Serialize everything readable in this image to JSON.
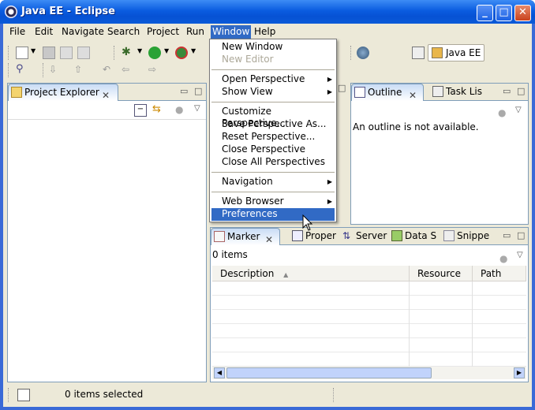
{
  "window": {
    "title": "Java EE - Eclipse"
  },
  "menubar": [
    {
      "label": "File"
    },
    {
      "label": "Edit"
    },
    {
      "label": "Navigate"
    },
    {
      "label": "Search"
    },
    {
      "label": "Project"
    },
    {
      "label": "Run"
    },
    {
      "label": "Window"
    },
    {
      "label": "Help"
    }
  ],
  "perspective": {
    "label": "Java EE"
  },
  "project_explorer": {
    "tab_label": "Project Explorer"
  },
  "outline": {
    "tab_label": "Outline",
    "message": "An outline is not available.",
    "task_tab": "Task Lis"
  },
  "markers": {
    "tabs": [
      {
        "label": "Marker"
      },
      {
        "label": "Proper"
      },
      {
        "label": "Server"
      },
      {
        "label": "Data S"
      },
      {
        "label": "Snippe"
      }
    ],
    "count_text": "0 items",
    "columns": [
      {
        "label": "Description"
      },
      {
        "label": "Resource"
      },
      {
        "label": "Path"
      }
    ]
  },
  "window_menu": {
    "items": [
      {
        "label": "New Window",
        "enabled": true
      },
      {
        "label": "New Editor",
        "enabled": false
      },
      {
        "label": "Open Perspective",
        "enabled": true,
        "submenu": true
      },
      {
        "label": "Show View",
        "enabled": true,
        "submenu": true
      },
      {
        "label": "Customize Perspective...",
        "enabled": true
      },
      {
        "label": "Save Perspective As...",
        "enabled": true
      },
      {
        "label": "Reset Perspective...",
        "enabled": true
      },
      {
        "label": "Close Perspective",
        "enabled": true
      },
      {
        "label": "Close All Perspectives",
        "enabled": true
      },
      {
        "label": "Navigation",
        "enabled": true,
        "submenu": true
      },
      {
        "label": "Web Browser",
        "enabled": true,
        "submenu": true
      },
      {
        "label": "Preferences",
        "enabled": true,
        "selected": true
      }
    ]
  },
  "status": {
    "text": "0 items selected"
  },
  "colors": {
    "selection": "#316ac5",
    "titlebar": "#0a5ce0",
    "chrome": "#ece9d8",
    "border": "#7f9db9"
  }
}
